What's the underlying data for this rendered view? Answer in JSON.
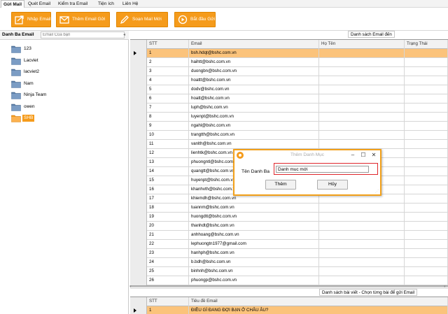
{
  "menu": {
    "tabs": [
      "Gửi Mail",
      "Quét Email",
      "Kiểm tra Email",
      "Tiện ích",
      "Liên Hệ"
    ]
  },
  "toolbar": {
    "import_email": "Nhập Email",
    "add_sent_email": "Thêm Email Gửi",
    "compose_mail": "Soạn Mail Mới",
    "start_send": "Bắt đầu Gửi"
  },
  "left": {
    "title": "Danh Ba Email",
    "search_placeholder": "Email Của bạn",
    "folders": [
      "123",
      "Lacviet",
      "lacviet2",
      "Nam",
      "Ninja Team",
      "owen",
      "SHB"
    ],
    "selected_folder": "SHB"
  },
  "email_list": {
    "caption": "Danh sách Email đến",
    "columns": [
      "STT",
      "Email",
      "Họ Tên",
      "Trạng Thái"
    ],
    "rows": [
      [
        "1",
        "bsh.hdqt@bshc.com.vn"
      ],
      [
        "2",
        "haihtt@bshc.com.vn"
      ],
      [
        "3",
        "duongbn@bshc.com.vn"
      ],
      [
        "4",
        "hoattt@bshc.com.vn"
      ],
      [
        "5",
        "dodv@bshc.com.vn"
      ],
      [
        "6",
        "hoatt@bshc.com.vn"
      ],
      [
        "7",
        "luph@bshc.com.vn"
      ],
      [
        "8",
        "luyenpt@bshc.com.vn"
      ],
      [
        "9",
        "ngahl@bshc.com.vn"
      ],
      [
        "10",
        "trangtth@bshc.com.vn"
      ],
      [
        "11",
        "vanlth@bshc.com.vn"
      ],
      [
        "12",
        "lienhtk@bshc.com.vn"
      ],
      [
        "13",
        "phuongntl@bshc.com.vn"
      ],
      [
        "14",
        "quangtt@bshc.com.vn"
      ],
      [
        "15",
        "huyenpt@bshc.com.vn"
      ],
      [
        "16",
        "khanhvth@bshc.com.vn"
      ],
      [
        "17",
        "khiemdh@bshc.com.vn"
      ],
      [
        "18",
        "tuannm@bshc.com.vn"
      ],
      [
        "19",
        "huongdtt@bshc.com.vn"
      ],
      [
        "20",
        "thanhdt@bshc.com.vn"
      ],
      [
        "21",
        "anhhoang@bshc.com.vn"
      ],
      [
        "22",
        "lephuongtn1977@gmail.com"
      ],
      [
        "23",
        "hanhph@bshc.com.vn"
      ],
      [
        "24",
        "b.bdh@bshc.com.vn"
      ],
      [
        "25",
        "binhnh@bshc.com.vn"
      ],
      [
        "26",
        "phuongp@bshc.com.vn"
      ]
    ]
  },
  "post_list": {
    "caption": "Danh sách bài viết - Chọn từng bài để gửi Email",
    "columns": [
      "STT",
      "Tiêu đề Email"
    ],
    "rows": [
      [
        "1",
        "ĐIỀU GÌ ĐANG ĐỢI BẠN Ở CHÂU ÂU?"
      ]
    ]
  },
  "dialog": {
    "title": "Thêm Danh Mục",
    "label": "Tên Danh Ba",
    "value": "Danh muc mới",
    "ok": "Thêm",
    "cancel": "Hủy"
  },
  "colors": {
    "accent": "#f59b1b",
    "selected_row": "#fbc37b",
    "dialog_border": "#f2a019",
    "input_highlight": "#e0262c"
  }
}
